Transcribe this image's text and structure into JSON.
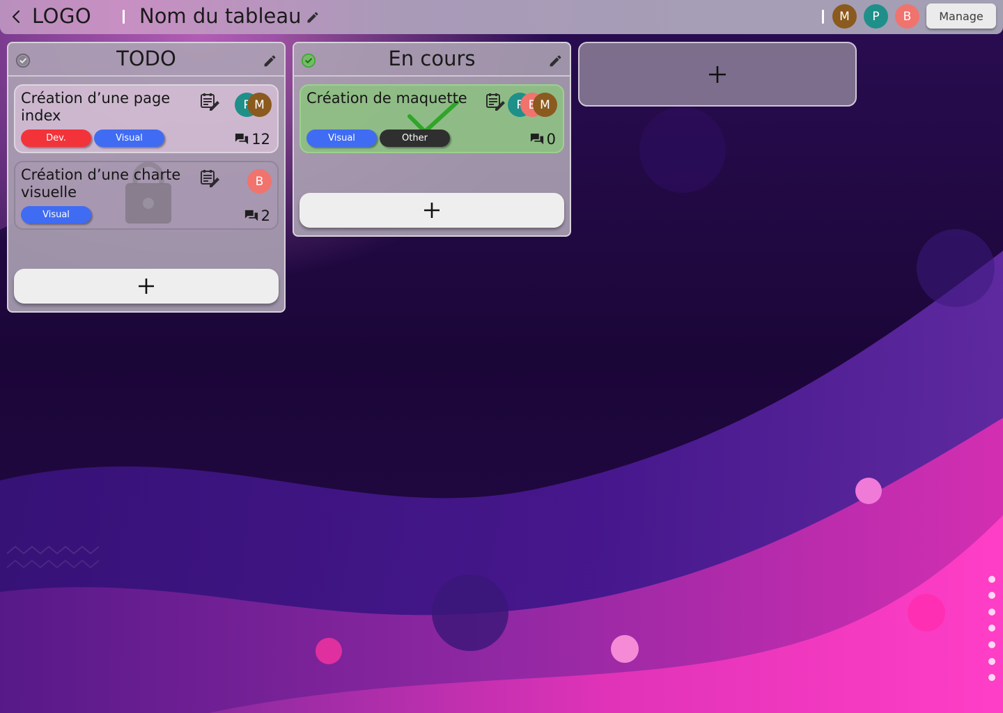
{
  "header": {
    "logo": "LOGO",
    "board_title": "Nom du tableau",
    "members": [
      {
        "initial": "M",
        "color": "#8b5a1e"
      },
      {
        "initial": "P",
        "color": "#1f8f8a"
      },
      {
        "initial": "B",
        "color": "#f0736e"
      }
    ],
    "manage_label": "Manage"
  },
  "columns": [
    {
      "title": "TODO",
      "done": false,
      "cards": [
        {
          "title": "Création d’une page index",
          "avatars": [
            {
              "initial": "P",
              "color": "#1f8f8a"
            },
            {
              "initial": "M",
              "color": "#8b5a1e"
            }
          ],
          "tags": [
            {
              "label": "Dev.",
              "color": "#f2333a"
            },
            {
              "label": "Visual",
              "color": "#3f6cf2"
            }
          ],
          "comments": "12",
          "locked": false
        },
        {
          "title": "Création d’une charte visuelle",
          "avatars": [
            {
              "initial": "B",
              "color": "#f0736e"
            }
          ],
          "tags": [
            {
              "label": "Visual",
              "color": "#3f6cf2"
            }
          ],
          "comments": "2",
          "locked": true
        }
      ]
    },
    {
      "title": "En cours",
      "done": true,
      "cards": [
        {
          "title": "Création de maquette",
          "avatars": [
            {
              "initial": "P",
              "color": "#1f8f8a"
            },
            {
              "initial": "B",
              "color": "#f0736e"
            },
            {
              "initial": "M",
              "color": "#8b5a1e"
            }
          ],
          "tags": [
            {
              "label": "Visual",
              "color": "#3f6cf2"
            },
            {
              "label": "Other",
              "color": "#2f2f2f"
            }
          ],
          "comments": "0",
          "completed": true
        }
      ]
    }
  ],
  "colors": {
    "accent_done": "#3fae2f",
    "header": "#a99ab8",
    "column": "#aca2b4"
  },
  "icons": {
    "back": "chevron-left-icon",
    "edit": "pencil-icon",
    "card_edit": "notes-edit-icon",
    "comments": "comments-icon",
    "add": "plus-icon",
    "lock": "lock-icon",
    "check": "check-circle-icon"
  }
}
